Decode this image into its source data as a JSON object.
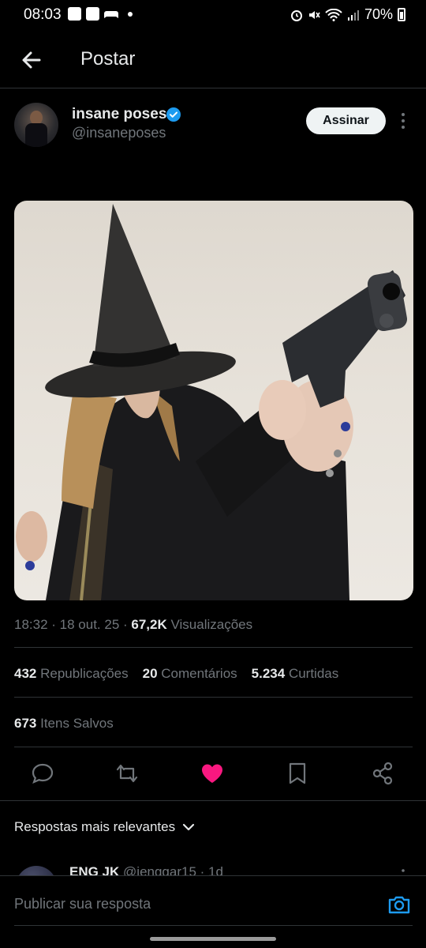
{
  "status_bar": {
    "time": "08:03",
    "battery": "70%"
  },
  "header": {
    "title": "Postar",
    "back_icon": "arrow-left-icon"
  },
  "author": {
    "name": "insane poses",
    "handle": "@insaneposes",
    "verified": true,
    "subscribe_label": "Assinar"
  },
  "meta": {
    "time": "18:32",
    "sep1": " · ",
    "date": "18 out. 25",
    "sep2": " · ",
    "views": "67,2K",
    "views_label": "Visualizações"
  },
  "stats": [
    {
      "count": "432",
      "label": "Republicações"
    },
    {
      "count": "20",
      "label": "Comentários"
    },
    {
      "count": "5.234",
      "label": "Curtidas"
    }
  ],
  "saved": {
    "count": "673",
    "label": "Itens Salvos"
  },
  "actions": [
    "reply-icon",
    "repost-icon",
    "like-icon",
    "bookmark-icon",
    "share-icon"
  ],
  "colors": {
    "accent_blue": "#1d9bf0",
    "like_pink": "#f91880",
    "background": "#000000",
    "text": "#e7e9ea",
    "muted": "#71767b"
  },
  "sort": {
    "label": "Respostas mais relevantes"
  },
  "reply_preview": {
    "name": "ENG JK",
    "handle": "@jenggar15",
    "age": "· 1d"
  },
  "compose": {
    "placeholder": "Publicar sua resposta"
  }
}
